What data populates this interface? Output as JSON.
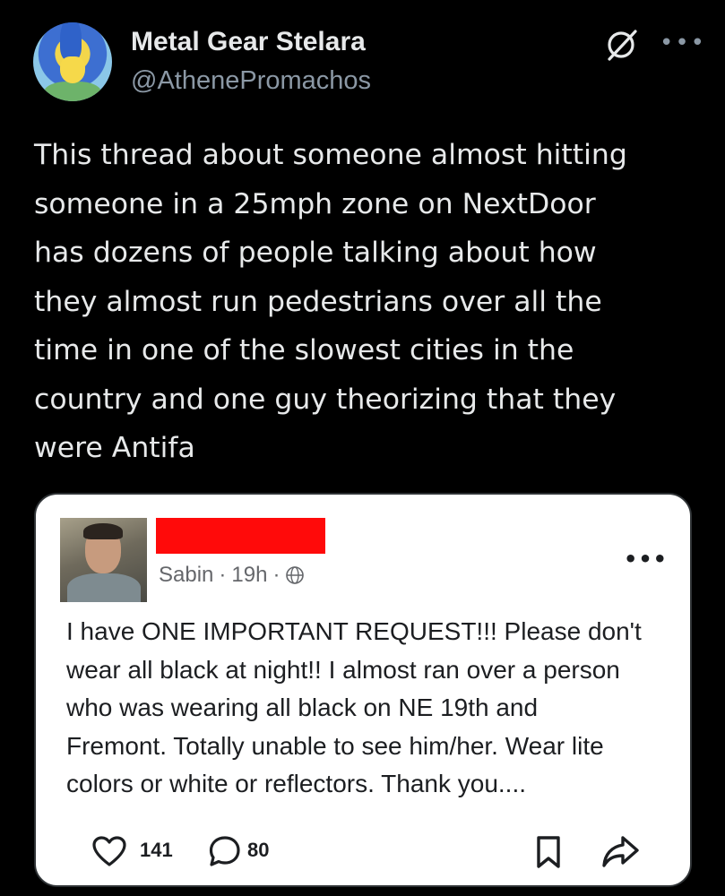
{
  "author": {
    "name": "Metal Gear Stelara",
    "handle": "@AthenePromachos"
  },
  "tweet": {
    "text": "This thread about someone almost hitting\nsomeone in a 25mph zone on NextDoor\nhas dozens of people talking about how\nthey almost run pedestrians over all the\ntime in one of the slowest cities in the\ncountry and one guy theorizing that they\nwere Antifa"
  },
  "embedded_post": {
    "location": "Sabin",
    "time": "19h",
    "separator": "·",
    "text": "I have ONE IMPORTANT REQUEST!!! Please don't\nwear all black at night!! I almost ran over a person\nwho was wearing all black on NE 19th and\nFremont. Totally unable to see him/her. Wear lite\ncolors or white or reflectors. Thank you....",
    "likes": "141",
    "replies": "80",
    "redaction_color": "#ff0a0a"
  },
  "icons": {
    "header": [
      "grok-icon",
      "more-icon"
    ],
    "post": [
      "globe-icon",
      "more-icon"
    ],
    "footer": [
      "heart-icon",
      "reply-icon",
      "bookmark-icon",
      "share-icon"
    ]
  },
  "colors": {
    "background": "#000000",
    "text": "#e7e9ea",
    "secondary_text": "#8b98a5"
  }
}
